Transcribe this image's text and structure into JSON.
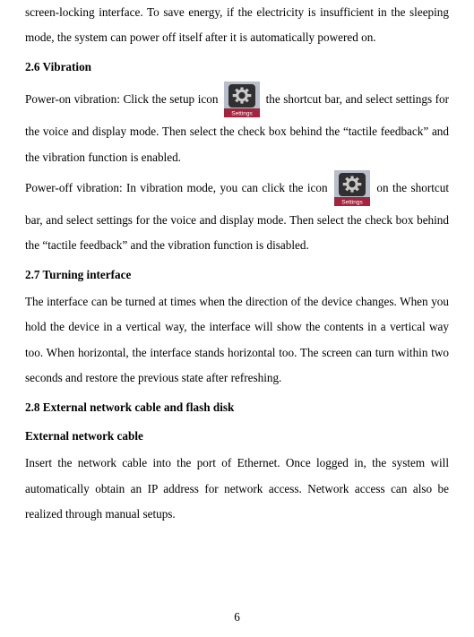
{
  "intro": "screen-locking interface. To save energy, if the electricity is insufficient in the sleeping mode, the system can power off itself after it is automatically powered on.",
  "h26": "2.6 Vibration",
  "vib_on_a": "Power-on vibration: Click the setup icon",
  "vib_on_b": "the shortcut bar, and select settings for the voice and display mode. Then select the check box behind the “tactile feedback” and the vibration function is enabled.",
  "vib_off_a": "Power-off vibration: In vibration mode, you can click the icon",
  "vib_off_b": "on the shortcut bar, and select settings for the voice and display mode. Then select the check box behind the “tactile feedback” and the vibration function is disabled.",
  "h27": "2.7 Turning interface",
  "turning": "The interface can be turned at times when the direction of the device changes. When you hold the device in a vertical way, the interface will show the contents in a vertical way too. When horizontal, the interface stands horizontal too. The screen can turn within two seconds and restore the previous state after refreshing.",
  "h28": "2.8 External network cable and flash disk",
  "h28sub": "External network cable",
  "ext": "Insert the network cable into the port of Ethernet. Once logged in, the system will automatically obtain an IP address for network access. Network access can also be realized through manual setups.",
  "pagenum": "6",
  "icon_label": "Settings"
}
